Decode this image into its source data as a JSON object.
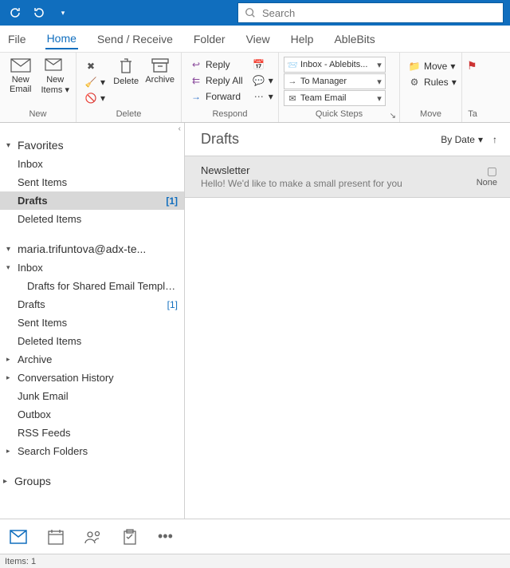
{
  "search": {
    "placeholder": "Search"
  },
  "menubar": {
    "file": "File",
    "home": "Home",
    "sendreceive": "Send / Receive",
    "folder": "Folder",
    "view": "View",
    "help": "Help",
    "ablebits": "AbleBits"
  },
  "ribbon": {
    "new": {
      "label": "New",
      "new_email": "New\nEmail",
      "new_items": "New\nItems"
    },
    "delete": {
      "label": "Delete",
      "delete": "Delete",
      "archive": "Archive"
    },
    "respond": {
      "label": "Respond",
      "reply": "Reply",
      "reply_all": "Reply All",
      "forward": "Forward"
    },
    "quicksteps": {
      "label": "Quick Steps",
      "items": [
        "Inbox - Ablebits...",
        "To Manager",
        "Team Email"
      ]
    },
    "move": {
      "label": "Move",
      "move": "Move",
      "rules": "Rules"
    },
    "tags": {
      "label": "Ta"
    }
  },
  "nav": {
    "favorites": {
      "label": "Favorites",
      "items": [
        {
          "label": "Inbox",
          "count": ""
        },
        {
          "label": "Sent Items",
          "count": ""
        },
        {
          "label": "Drafts",
          "count": "[1]",
          "selected": true
        },
        {
          "label": "Deleted Items",
          "count": ""
        }
      ]
    },
    "account": {
      "label": "maria.trifuntova@adx-te...",
      "items": [
        {
          "label": "Inbox",
          "expandable": true,
          "expanded": true
        },
        {
          "label": "Drafts for Shared Email Templa...",
          "sub": true
        },
        {
          "label": "Drafts",
          "count": "[1]"
        },
        {
          "label": "Sent Items"
        },
        {
          "label": "Deleted Items"
        },
        {
          "label": "Archive",
          "expandable": true
        },
        {
          "label": "Conversation History",
          "expandable": true
        },
        {
          "label": "Junk Email"
        },
        {
          "label": "Outbox"
        },
        {
          "label": "RSS Feeds"
        },
        {
          "label": "Search Folders",
          "expandable": true
        }
      ]
    },
    "groups": {
      "label": "Groups"
    }
  },
  "list": {
    "title": "Drafts",
    "sort_label": "By Date",
    "messages": [
      {
        "subject": "Newsletter",
        "preview": "Hello!  We'd like to make a small present for you",
        "category": "None"
      }
    ]
  },
  "status": {
    "items": "Items: 1"
  }
}
